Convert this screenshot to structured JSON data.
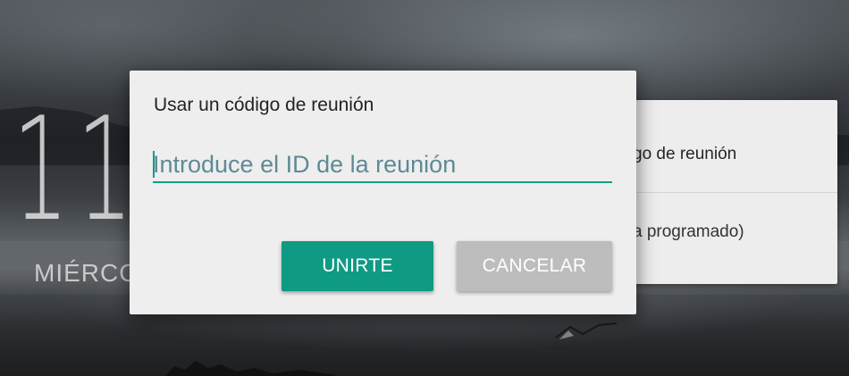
{
  "lock_screen": {
    "clock_partial": "11",
    "date_partial": "MIÉRCO"
  },
  "background_card": {
    "item1_partial": "go de reunión",
    "item2_partial": "a programado)"
  },
  "dialog": {
    "title": "Usar un código de reunión",
    "input": {
      "value": "",
      "placeholder": "Introduce el ID de la reunión"
    },
    "join_label": "UNIRTE",
    "cancel_label": "CANCELAR"
  },
  "colors": {
    "accent": "#0f9a83",
    "cancel": "#bdbdbd",
    "dialog_bg": "#eeeeee"
  }
}
